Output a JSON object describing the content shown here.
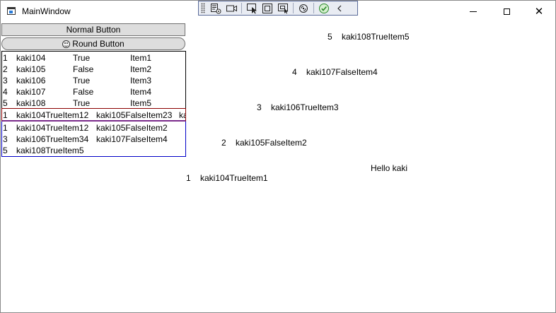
{
  "window": {
    "title": "MainWindow"
  },
  "debug_toolbar": {
    "icons": [
      "live-visual-tree-icon",
      "record-icon",
      "select-element-icon",
      "display-layout-adorners-icon",
      "track-focus-icon",
      "hot-reload-icon",
      "binding-check-icon",
      "collapse-chevron-icon"
    ]
  },
  "buttons": {
    "normal_label": "Normal Button",
    "round_label": "Round Button"
  },
  "grid_rows": [
    {
      "index": "1",
      "name": "kaki104",
      "flag": "True",
      "item": "Item1"
    },
    {
      "index": "2",
      "name": "kaki105",
      "flag": "False",
      "item": "Item2"
    },
    {
      "index": "3",
      "name": "kaki106",
      "flag": "True",
      "item": "Item3"
    },
    {
      "index": "4",
      "name": "kaki107",
      "flag": "False",
      "item": "Item4"
    },
    {
      "index": "5",
      "name": "kaki108",
      "flag": "True",
      "item": "Item5"
    }
  ],
  "horizontal_list": [
    {
      "index": "1",
      "text": "kaki104TrueItem12"
    },
    {
      "index": "",
      "text": "kaki105FalseItem23"
    },
    {
      "index": "",
      "text": "ka"
    }
  ],
  "wrap_list": [
    {
      "index": "1",
      "text": "kaki104TrueItem12"
    },
    {
      "index": "",
      "text": "kaki105FalseItem2"
    },
    {
      "index": "3",
      "text": "kaki106TrueItem34"
    },
    {
      "index": "",
      "text": "kaki107FalseItem4"
    },
    {
      "index": "5",
      "text": "kaki108TrueItem5"
    }
  ],
  "canvas_items": [
    {
      "index": "5",
      "text": "kaki108TrueItem5"
    },
    {
      "index": "4",
      "text": "kaki107FalseItem4"
    },
    {
      "index": "3",
      "text": "kaki106TrueItem3"
    },
    {
      "index": "2",
      "text": "kaki105FalseItem2"
    },
    {
      "index": "1",
      "text": "kaki104TrueItem1"
    }
  ],
  "greeting": "Hello kaki"
}
